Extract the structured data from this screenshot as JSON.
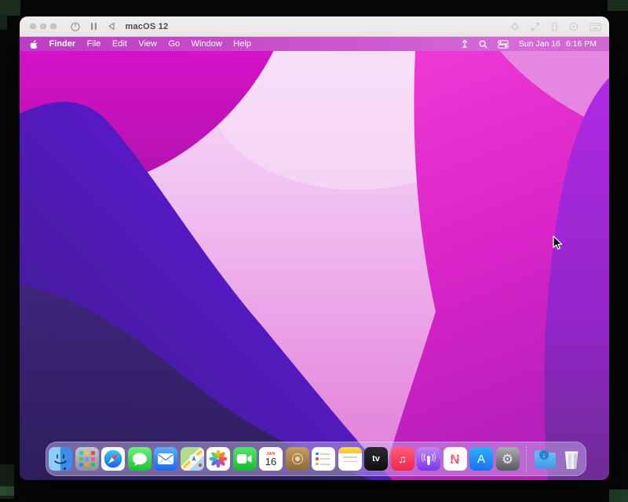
{
  "vm_window": {
    "title": "macOS 12",
    "toolbar_left_icons": [
      "power-icon",
      "pause-icon",
      "back-icon"
    ],
    "toolbar_right_icons": [
      "fit-screen-icon",
      "fullscreen-icon",
      "usb-icon",
      "disc-icon",
      "keyboard-icon"
    ],
    "traffic_light_color": "#c8c5c5"
  },
  "menu_bar": {
    "items": [
      "Finder",
      "File",
      "Edit",
      "View",
      "Go",
      "Window",
      "Help"
    ],
    "status": {
      "icons": [
        "status-arrow-icon",
        "spotlight-search-icon",
        "control-center-icon"
      ],
      "date": "Sun Jan 16",
      "time": "6:16 PM"
    },
    "accent": "#c74bc9"
  },
  "wallpaper": {
    "name": "macOS Monterey abstract waves",
    "colors": [
      "#f7e0f8",
      "#d912ca",
      "#5a18cc",
      "#2c1e58",
      "#d924c8",
      "#9325c9"
    ]
  },
  "dock": {
    "apps": [
      {
        "id": "finder",
        "label": "Finder",
        "running": true
      },
      {
        "id": "launchpad",
        "label": "Launchpad"
      },
      {
        "id": "safari",
        "label": "Safari"
      },
      {
        "id": "messages",
        "label": "Messages"
      },
      {
        "id": "mail",
        "label": "Mail"
      },
      {
        "id": "maps",
        "label": "Maps"
      },
      {
        "id": "photos",
        "label": "Photos"
      },
      {
        "id": "facetime",
        "label": "FaceTime"
      },
      {
        "id": "calendar",
        "label": "Calendar",
        "month": "JAN",
        "day": "16"
      },
      {
        "id": "contacts",
        "label": "Contacts"
      },
      {
        "id": "reminders",
        "label": "Reminders"
      },
      {
        "id": "notes",
        "label": "Notes"
      },
      {
        "id": "tv",
        "label": "TV",
        "text": "tv"
      },
      {
        "id": "music",
        "label": "Music",
        "glyph": "♫"
      },
      {
        "id": "podcasts",
        "label": "Podcasts"
      },
      {
        "id": "news",
        "label": "News",
        "text": "N"
      },
      {
        "id": "appstore",
        "label": "App Store",
        "text": "A"
      },
      {
        "id": "settings",
        "label": "System Preferences",
        "glyph": "⚙"
      },
      {
        "id": "downloads",
        "label": "Downloads",
        "glyph": "↓"
      },
      {
        "id": "trash",
        "label": "Trash"
      }
    ]
  }
}
